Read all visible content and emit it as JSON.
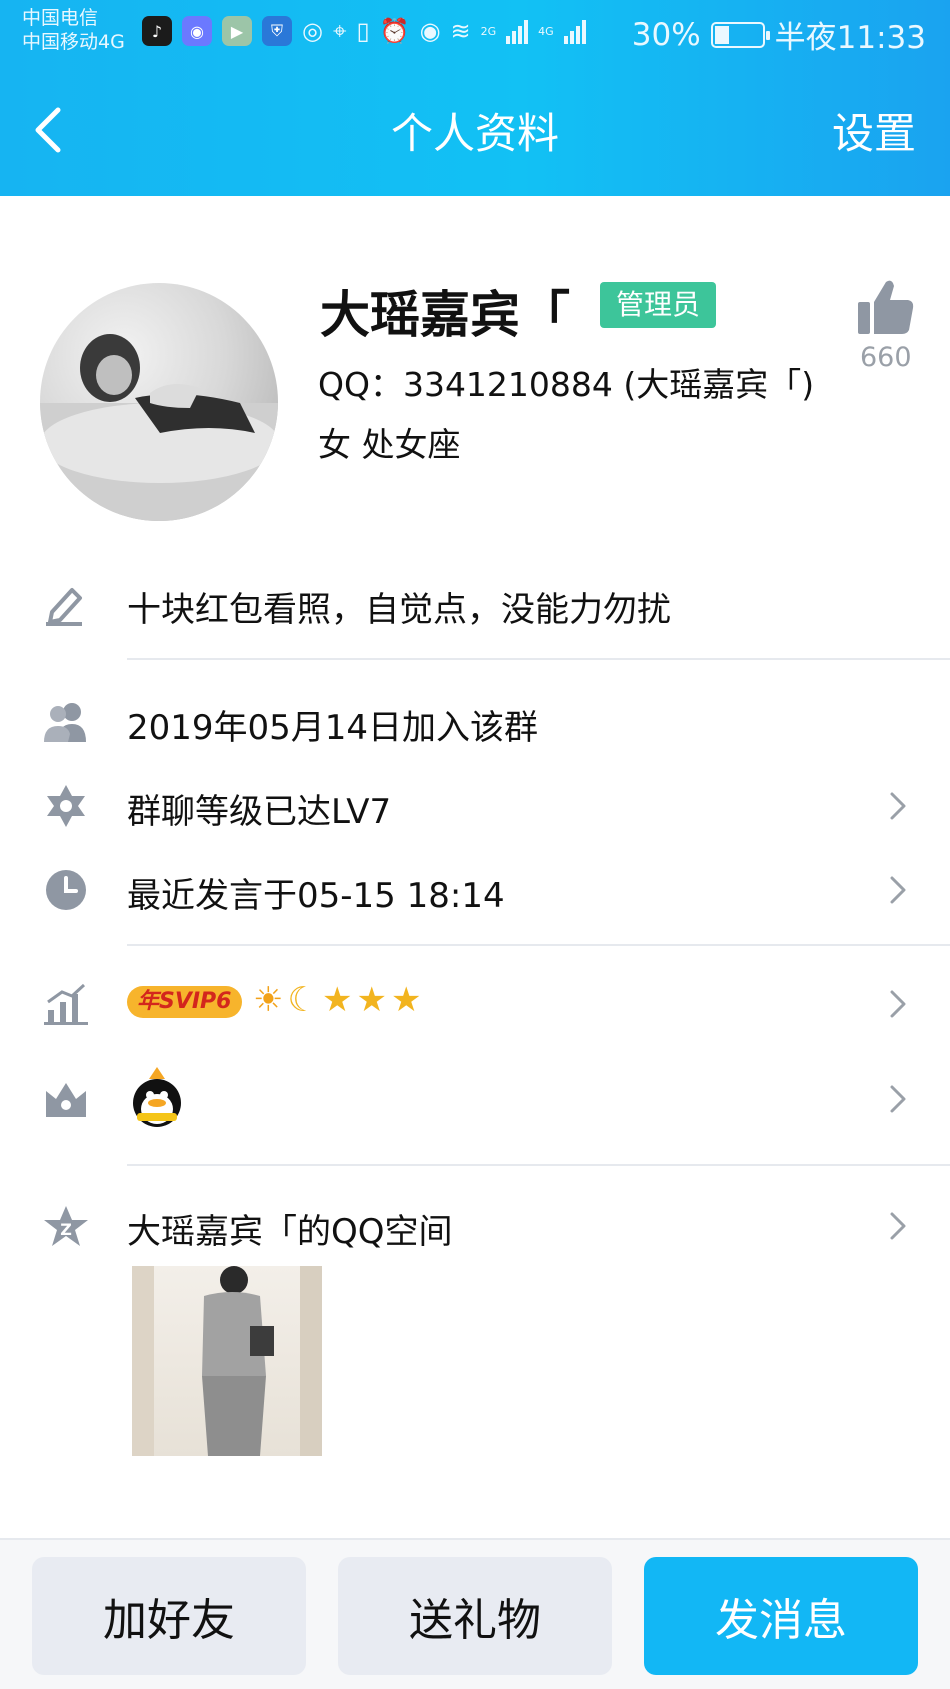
{
  "status_bar": {
    "carrier_1": "中国电信",
    "carrier_2": "中国移动4G",
    "net_1": "2G",
    "net_2": "4G",
    "battery": "30%",
    "time": "半夜11:33"
  },
  "nav": {
    "title": "个人资料",
    "settings": "设置"
  },
  "profile": {
    "name": "大瑶嘉宾「",
    "role_badge": "管理员",
    "qq_line": "QQ：3341210884 (大瑶嘉宾「)",
    "gender_sign": "女  处女座",
    "like_count": "660"
  },
  "rows": {
    "signature": "十块红包看照，自觉点，没能力勿扰",
    "joined": "2019年05月14日加入该群",
    "level": "群聊等级已达LV7",
    "last_spoke": "最近发言于05-15 18:14",
    "svip_badge": "年SVIP6",
    "qzone": "大瑶嘉宾「的QQ空间"
  },
  "buttons": {
    "add_friend": "加好友",
    "send_gift": "送礼物",
    "send_message": "发消息"
  },
  "colors": {
    "header_blue": "#12c1f4",
    "admin_green": "#3dc59a",
    "primary_button": "#12b7f5"
  }
}
